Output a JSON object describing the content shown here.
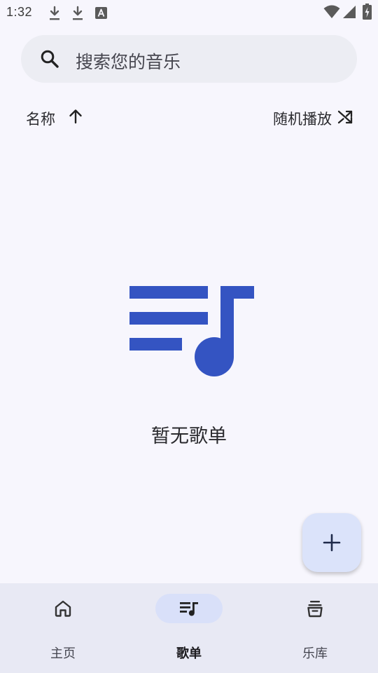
{
  "status_bar": {
    "time": "1:32",
    "icons": [
      "download-icon",
      "download-icon",
      "font-a-icon",
      "wifi-icon",
      "cellular-signal-icon",
      "battery-charging-icon"
    ]
  },
  "search": {
    "placeholder": "搜索您的音乐",
    "icon": "search-icon"
  },
  "sort": {
    "label": "名称",
    "direction_icon": "arrow-up-icon",
    "shuffle_label": "随机播放",
    "shuffle_icon": "shuffle-icon"
  },
  "empty_state": {
    "icon": "playlist-music-icon",
    "text": "暂无歌单"
  },
  "fab": {
    "icon": "add-icon"
  },
  "bottom_nav": {
    "items": [
      {
        "label": "主页",
        "icon": "home-icon",
        "active": false
      },
      {
        "label": "歌单",
        "icon": "playlist-icon",
        "active": true
      },
      {
        "label": "乐库",
        "icon": "library-icon",
        "active": false
      }
    ]
  },
  "colors": {
    "background": "#f7f6fd",
    "accent": "#3454c2",
    "search_bg": "#ecedf3",
    "nav_bg": "#e8e9f4",
    "nav_indicator": "#d9e0f9",
    "fab_bg": "#dbe3fa"
  }
}
